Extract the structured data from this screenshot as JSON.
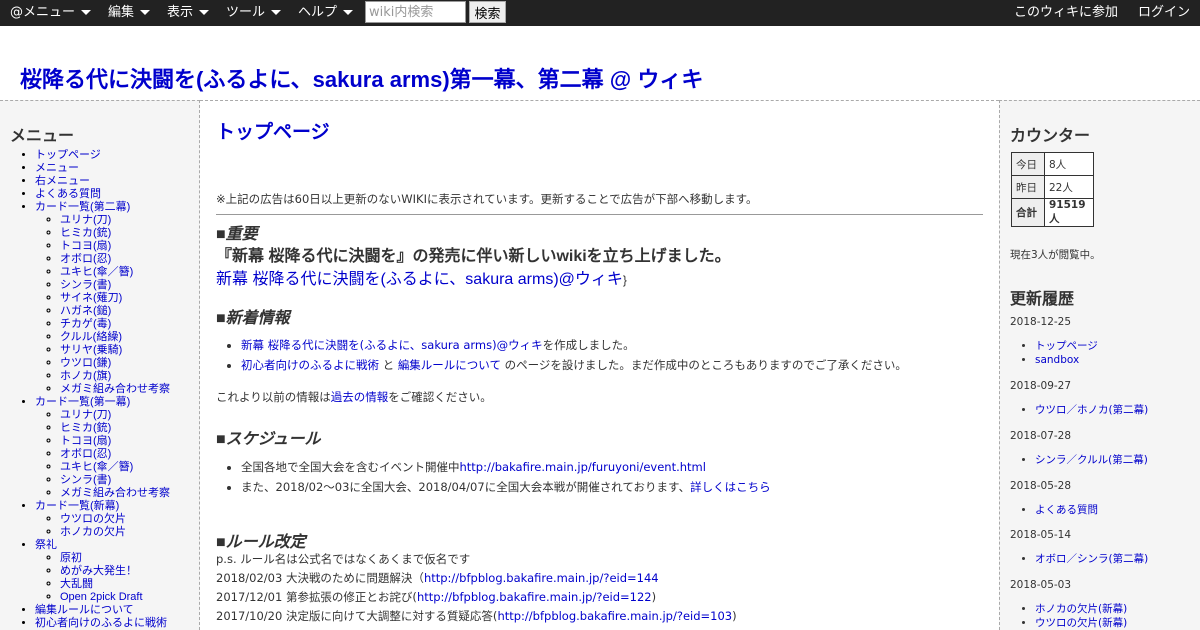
{
  "topbar": {
    "menu_at": "@メニュー",
    "menu_edit": "編集",
    "menu_view": "表示",
    "menu_tools": "ツール",
    "menu_help": "ヘルプ",
    "search_placeholder": "wiki内検索",
    "search_button": "検索",
    "join": "このウィキに参加",
    "login": "ログイン"
  },
  "site": {
    "title": "桜降る代に決闘を(ふるよに、sakura arms)第一幕、第二幕 @ ウィキ"
  },
  "left_menu": {
    "heading": "メニュー",
    "items": [
      {
        "label": "トップページ"
      },
      {
        "label": "メニュー"
      },
      {
        "label": "右メニュー"
      },
      {
        "label": "よくある質問"
      },
      {
        "label": "カード一覧(第二幕)",
        "children": [
          "ユリナ(刀)",
          "ヒミカ(銃)",
          "トコヨ(扇)",
          "オボロ(忍)",
          "ユキヒ(傘／簪)",
          "シンラ(書)",
          "サイネ(薙刀)",
          "ハガネ(鎚)",
          "チカゲ(毒)",
          "クルル(絡繰)",
          "サリヤ(乗騎)",
          "ウツロ(鎌)",
          "ホノカ(旗)",
          "メガミ組み合わせ考察"
        ]
      },
      {
        "label": "カード一覧(第一幕)",
        "children": [
          "ユリナ(刀)",
          "ヒミカ(銃)",
          "トコヨ(扇)",
          "オボロ(忍)",
          "ユキヒ(傘／簪)",
          "シンラ(書)",
          "メガミ組み合わせ考察"
        ]
      },
      {
        "label": "カード一覧(新幕)",
        "children": [
          "ウツロの欠片",
          "ホノカの欠片"
        ]
      },
      {
        "label": "祭礼",
        "children": [
          "原初",
          "めがみ大発生！",
          "大乱闘",
          "Open 2pick Draft"
        ]
      },
      {
        "label": "編集ルールについて"
      },
      {
        "label": "初心者向けのふるよに戦術"
      }
    ]
  },
  "main": {
    "page_title": "トップページ",
    "ad_note": "※上記の広告は60日以上更新のないWIKIに表示されています。更新することで広告が下部へ移動します。",
    "important": {
      "square": "■",
      "heading": "重要",
      "bold_text": "『新幕 桜降る代に決闘を』の発売に伴い新しいwikiを立ち上げました。",
      "link": "新幕 桜降る代に決闘を(ふるよに、sakura arms)@ウィキ",
      "brace": "}"
    },
    "news": {
      "square": "■",
      "heading": "新着情報",
      "item1_link": "新幕 桜降る代に決闘を(ふるよに、sakura arms)@ウィキ",
      "item1_text": "を作成しました。",
      "item2_link_a": "初心者向けのふるよに戦術",
      "item2_and": " と ",
      "item2_link_b": "編集ルールについて",
      "item2_text": " のページを設けました。まだ作成中のところもありますのでご了承ください。",
      "past_prefix": "これより以前の情報は",
      "past_link": "過去の情報",
      "past_suffix": "をご確認ください。"
    },
    "schedule": {
      "square": "■",
      "heading": "スケジュール",
      "item1_text": "全国各地で全国大会を含むイベント開催中",
      "item1_link": "http://bakafire.main.jp/furuyoni/event.html",
      "item2_text": "また、2018/02～03に全国大会、2018/04/07に全国大会本戦が開催されております、",
      "item2_link": "詳しくはこちら"
    },
    "rules": {
      "square": "■",
      "heading": "ルール改定",
      "ps": "p.s. ルール名は公式名ではなくあくまで仮名です",
      "lines": [
        {
          "prefix": "2018/02/03 大決戦のために問題解決（",
          "link": "http://bfpblog.bakafire.main.jp/?eid=144",
          "suffix": ""
        },
        {
          "prefix": "2017/12/01 第参拡張の修正とお詫び(",
          "link": "http://bfpblog.bakafire.main.jp/?eid=122",
          "suffix": ")"
        },
        {
          "prefix": "2017/10/20 決定版に向けて大調整に対する質疑応答(",
          "link": "http://bfpblog.bakafire.main.jp/?eid=103",
          "suffix": ")"
        }
      ]
    }
  },
  "right": {
    "counter_heading": "カウンター",
    "counter": [
      {
        "label": "今日",
        "value": "8人"
      },
      {
        "label": "昨日",
        "value": "22人"
      },
      {
        "label": "合計",
        "value": "91519人"
      }
    ],
    "viewing": "現在3人が閲覧中。",
    "history_heading": "更新履歴",
    "history": [
      {
        "date": "2018-12-25",
        "items": [
          "トップページ",
          "sandbox"
        ]
      },
      {
        "date": "2018-09-27",
        "items": [
          "ウツロ／ホノカ(第二幕)"
        ]
      },
      {
        "date": "2018-07-28",
        "items": [
          "シンラ／クルル(第二幕)"
        ]
      },
      {
        "date": "2018-05-28",
        "items": [
          "よくある質問"
        ]
      },
      {
        "date": "2018-05-14",
        "items": [
          "オボロ／シンラ(第二幕)"
        ]
      },
      {
        "date": "2018-05-03",
        "items": [
          "ホノカの欠片(新幕)",
          "ウツロの欠片(新幕)"
        ]
      }
    ]
  }
}
